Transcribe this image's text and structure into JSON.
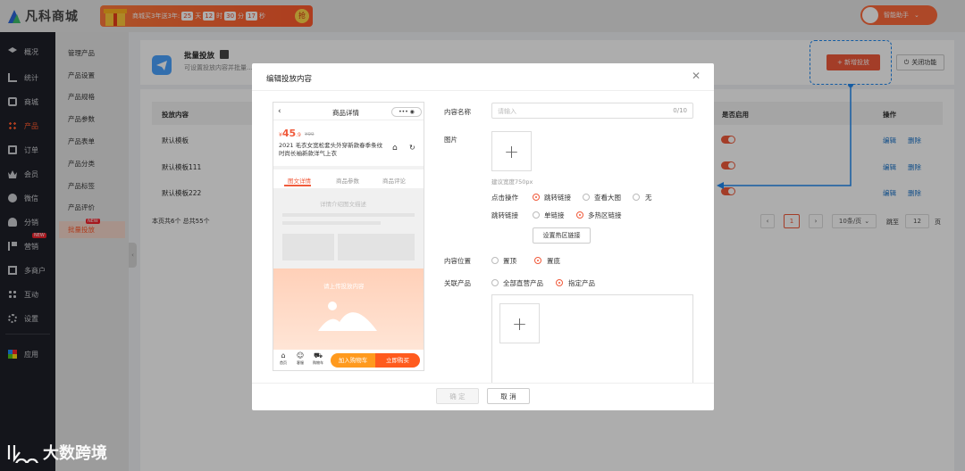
{
  "app": {
    "name": "凡科商城",
    "brand_color": "#ff5b2e"
  },
  "promo": {
    "text": "商城买3年送3年:",
    "d": "25",
    "d_unit": "天",
    "h": "12",
    "h_unit": "时",
    "m": "30",
    "m_unit": "分",
    "s": "17",
    "s_unit": "秒",
    "grab": "抢"
  },
  "helper": {
    "label": "智能助手"
  },
  "sidebar": {
    "items": [
      {
        "label": "概况"
      },
      {
        "label": "统计"
      },
      {
        "label": "商城"
      },
      {
        "label": "产品"
      },
      {
        "label": "订单"
      },
      {
        "label": "会员"
      },
      {
        "label": "微信"
      },
      {
        "label": "分销"
      },
      {
        "label": "营销",
        "badge": "NEW"
      },
      {
        "label": "多商户"
      },
      {
        "label": "互动"
      },
      {
        "label": "设置"
      },
      {
        "label": "应用"
      }
    ]
  },
  "submenu": {
    "items": [
      "管理产品",
      "产品设置",
      "产品规格",
      "产品参数",
      "产品表单",
      "产品分类",
      "产品标签",
      "产品评价",
      "批量投放"
    ],
    "active_badge": "NEW"
  },
  "page": {
    "title": "批量投放",
    "desc": "可设置投放内容并批量…",
    "new_btn": "+ 新增投放",
    "close_btn": "关闭功能"
  },
  "table": {
    "headers": [
      "投放内容",
      "是否启用",
      "操作"
    ],
    "rows": [
      {
        "name": "默认模板",
        "edit": "编辑",
        "del": "删除"
      },
      {
        "name": "默认模板111",
        "edit": "编辑",
        "del": "删除"
      },
      {
        "name": "默认模板222",
        "edit": "编辑",
        "del": "删除"
      }
    ],
    "summary": "本页共6个  总共55个"
  },
  "pagination": {
    "current": "1",
    "per_page": "10条/页",
    "goto_label": "跳至",
    "goto_value": "12",
    "page_unit": "页"
  },
  "modal": {
    "title": "编辑投放内容",
    "confirm": "确 定",
    "cancel": "取 消",
    "form": {
      "name_label": "内容名称",
      "name_placeholder": "请输入",
      "name_count": "0/10",
      "image_label": "图片",
      "image_hint": "建议宽度750px",
      "click_label": "点击操作",
      "click_options": [
        "跳转链接",
        "查看大图",
        "无"
      ],
      "jump_label": "跳转链接",
      "jump_options": [
        "单链接",
        "多热区链接"
      ],
      "hotzone_btn": "设置热区链接",
      "position_label": "内容位置",
      "position_options": [
        "置顶",
        "置底"
      ],
      "product_label": "关联产品",
      "product_options": [
        "全部直营产品",
        "指定产品"
      ]
    },
    "phone": {
      "header": "商品详情",
      "price": "45",
      "price_symbol": "¥",
      "price_decimal": ".9",
      "old_price": "¥99",
      "product_title": "2021 毛衣女宽松套头外穿新款春季条纹时尚长袖新款洋气上衣",
      "tabs": [
        "图文详情",
        "商品参数",
        "商品评论"
      ],
      "intro": "详情介绍图文描述",
      "upload": "请上传投放内容",
      "bottom_icons": [
        "首页",
        "客服",
        "购物车"
      ],
      "cart_btn": "加入购物车",
      "buy_btn": "立即购买"
    }
  },
  "watermark": {
    "text": "大数跨境"
  }
}
